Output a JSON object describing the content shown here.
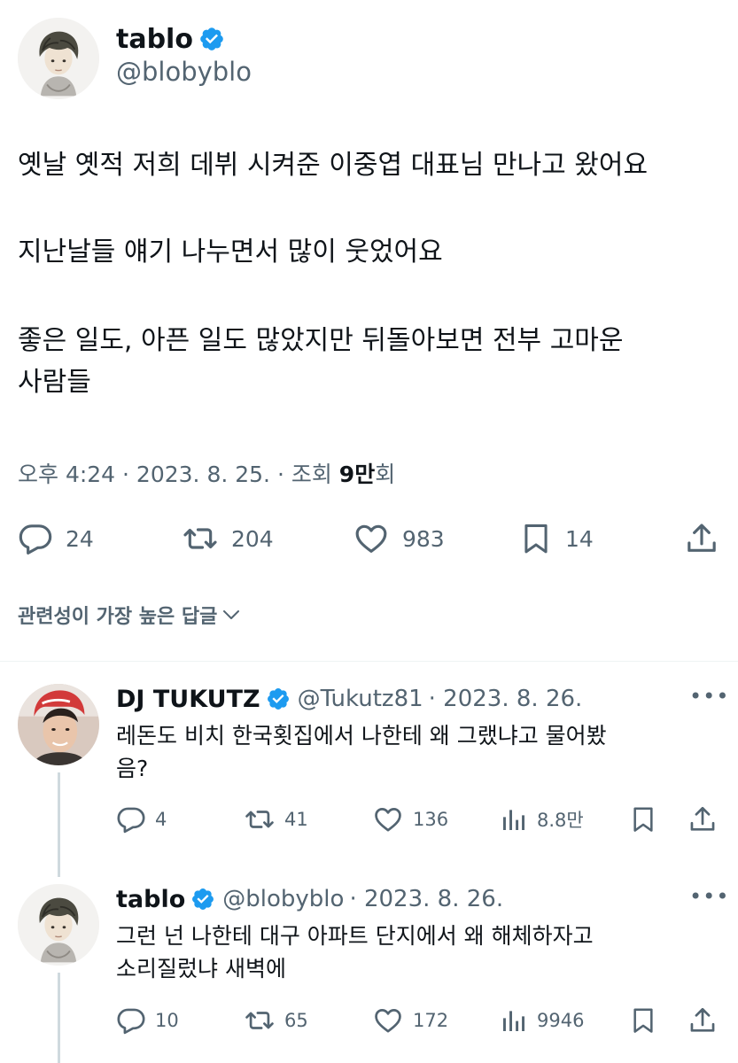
{
  "main_tweet": {
    "author_name": "tablo",
    "author_handle": "@blobyblo",
    "lines": [
      "옛날 옛적 저희 데뷔 시켜준 이중엽 대표님 만나고 왔어요",
      "지난날들 얘기 나누면서 많이 웃었어요",
      "좋은 일도, 아픈 일도 많았지만 뒤돌아보면 전부 고마운",
      "사람들"
    ],
    "meta_prefix": "오후 4:24 · 2023. 8. 25. · 조회 ",
    "views_value": "9만",
    "views_suffix": "회",
    "replies": "24",
    "reposts": "204",
    "likes": "983",
    "bookmarks": "14"
  },
  "sort": {
    "label": "관련성이 가장 높은 답글"
  },
  "replies": [
    {
      "author_name": "DJ TUKUTZ",
      "author_handle": "@Tukutz81",
      "date": "· 2023. 8. 26.",
      "lines": [
        "레돈도 비치 한국횟집에서 나한테 왜 그랬냐고 물어봤",
        "음?"
      ],
      "replies": "4",
      "reposts": "41",
      "likes": "136",
      "views": "8.8만"
    },
    {
      "author_name": "tablo",
      "author_handle": "@blobyblo",
      "date": "· 2023. 8. 26.",
      "lines": [
        "그런 넌 나한테 대구 아파트 단지에서 왜 해체하자고",
        "소리질렀냐 새벽에"
      ],
      "replies": "10",
      "reposts": "65",
      "likes": "172",
      "views": "9946"
    }
  ],
  "colors": {
    "verified": "#1d9bf0",
    "secondary_text": "#536471",
    "primary_text": "#0f1419"
  },
  "icons": [
    "verified-icon",
    "reply-icon",
    "repost-icon",
    "like-icon",
    "bookmark-icon",
    "share-icon",
    "views-icon",
    "more-icon",
    "chevron-down-icon"
  ]
}
